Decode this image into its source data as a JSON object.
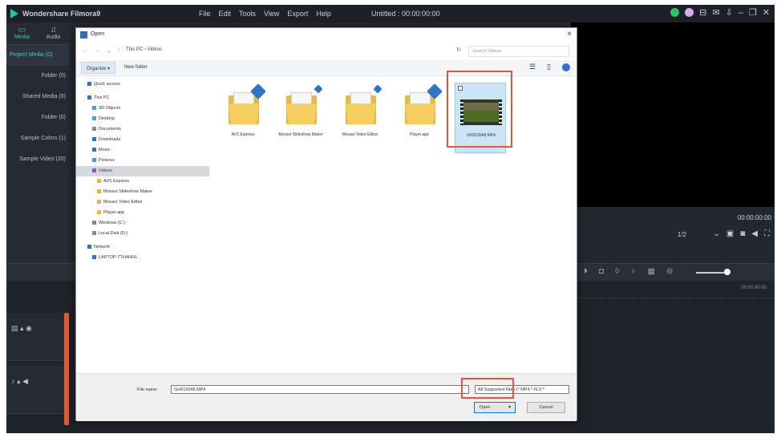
{
  "app": {
    "name": "Wondershare Filmora9",
    "menu": [
      "File",
      "Edit",
      "Tools",
      "View",
      "Export",
      "Help"
    ],
    "project_title": "Untitled : 00:00:00:00"
  },
  "left_panel": {
    "tabs": [
      {
        "label": "Media"
      },
      {
        "label": "Audio"
      }
    ],
    "libraries": [
      {
        "label": "Project Media (0)"
      },
      {
        "label": "Folder (0)"
      },
      {
        "label": "Shared Media (0)"
      },
      {
        "label": "Folder (0)"
      },
      {
        "label": "Sample Colors (1)"
      },
      {
        "label": "Sample Video (20)"
      }
    ]
  },
  "preview": {
    "timecode": "00:00:00:00",
    "zoom": "1/2"
  },
  "timeline": {
    "ruler_time": "00:00:40:00"
  },
  "dialog": {
    "title": "Open",
    "close": "×",
    "breadcrumb": "This PC  ›  Videos",
    "search_placeholder": "Search Videos",
    "organize": "Organize ▾",
    "new_folder": "New folder",
    "nav_items": [
      {
        "label": "Quick access",
        "color": "#2d6fd3"
      },
      {
        "label": "This PC",
        "color": "#2d6fd3"
      },
      {
        "label": "3D Objects",
        "color": "#3fa1e0"
      },
      {
        "label": "Desktop",
        "color": "#3fa1e0"
      },
      {
        "label": "Documents",
        "color": "#8a8a8a"
      },
      {
        "label": "Downloads",
        "color": "#2d6fd3"
      },
      {
        "label": "Music",
        "color": "#2d6fd3"
      },
      {
        "label": "Pictures",
        "color": "#3fa1e0"
      },
      {
        "label": "Videos",
        "color": "#7a5bd1"
      },
      {
        "label": "AVS Express",
        "color": "#e8b93a"
      },
      {
        "label": "Movavi Slideshow Maker",
        "color": "#e8b93a"
      },
      {
        "label": "Movavi Video Editor",
        "color": "#e8b93a"
      },
      {
        "label": "Player.app",
        "color": "#e8b93a"
      },
      {
        "label": "Windows (C:)",
        "color": "#6a8fb5"
      },
      {
        "label": "Local Disk (D:)",
        "color": "#8a8a8a"
      },
      {
        "label": "Network",
        "color": "#2d6fd3"
      },
      {
        "label": "LAPTOP-7TH4HI9L",
        "color": "#2d6fd3"
      }
    ],
    "files": [
      {
        "label": "AVS Express"
      },
      {
        "label": "Movavi Slideshow Maker"
      },
      {
        "label": "Movavi Video Editor"
      },
      {
        "label": "Player.app"
      },
      {
        "label": "GH010048.MP4"
      }
    ],
    "file_name_label": "File name:",
    "file_name_value": "GH010048.MP4",
    "file_type": "All Supported Files (*.MP4;*.FLV;*",
    "open_button": "Open",
    "open_arrow": "▼",
    "cancel_button": "Cancel"
  },
  "colors": {
    "accent": "#39c4c4",
    "annotation": "#e8553a",
    "app_bg": "#23272f"
  }
}
